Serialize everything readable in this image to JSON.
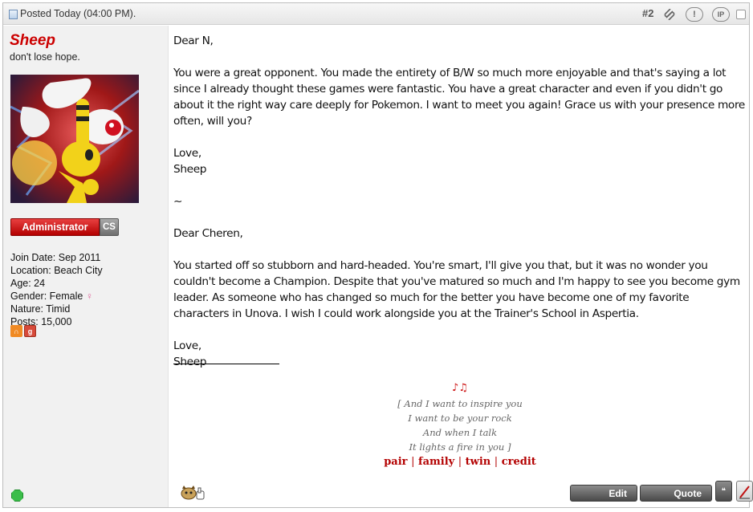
{
  "header": {
    "posted": "Posted Today (04:00 PM).",
    "post_number": "#2",
    "link_icon": "paperclip-link-icon",
    "report_icon": "report-exclamation-icon",
    "ip_label": "IP"
  },
  "user": {
    "name": "Sheep",
    "title": "don't lose hope.",
    "rank": "Administrator",
    "badge": "CS",
    "details": [
      {
        "text": "Join Date: Sep 2011"
      },
      {
        "text": "Location: Beach City"
      },
      {
        "text": "Age: 24"
      },
      {
        "text": "Gender: Female",
        "symbol": "♀"
      },
      {
        "text": "Nature: Timid"
      },
      {
        "text": "Posts: 15,000"
      }
    ],
    "name_color": "#cc0000"
  },
  "message": {
    "greeting1": "Dear N,",
    "para1": "You were a great opponent. You made the entirety of B/W so much more enjoyable and that's saying a lot since I already thought these games were fantastic. You have a great character and even if you didn't go about it the right way care deeply for Pokemon. I want to meet you again! Grace us with your presence more often, will you?",
    "closing1a": "Love,",
    "closing1b": "Sheep",
    "divider": "~",
    "greeting2": "Dear Cheren,",
    "para2": "You started off so stubborn and hard-headed. You're smart, I'll give you that, but it was no wonder you couldn't become a Champion. Despite that you've matured so much and I'm happy to see you become gym leader. As someone who has changed so much for the better you have become one of my favorite characters in Unova. I wish I could work alongside you at the Trainer's School in Aspertia.",
    "closing2a": "Love,",
    "closing2b": "Sheep"
  },
  "signature": {
    "notes": "♪♫",
    "lines": [
      "[ And I want to inspire you",
      "I want to be your rock",
      "And when I talk",
      "It lights a fire in you ]"
    ],
    "links": [
      "pair",
      "family",
      "twin",
      "credit"
    ],
    "link_color": "#b30000"
  },
  "actions": {
    "edit": "Edit",
    "quote": "Quote"
  }
}
